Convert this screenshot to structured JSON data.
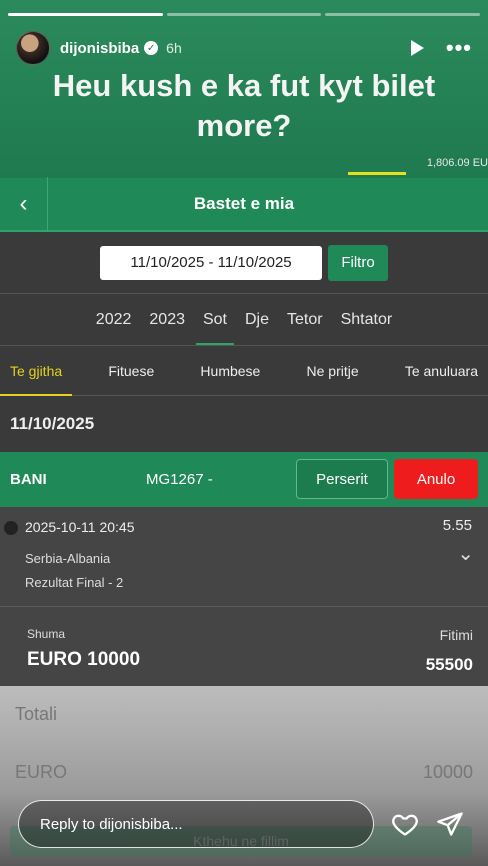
{
  "story": {
    "username": "dijonisbiba",
    "time": "6h",
    "caption": "Heu kush e ka fut kyt bilet more?",
    "peek_amount": "1,806.09 EU",
    "reply_placeholder": "Reply to dijonisbiba..."
  },
  "app": {
    "title": "Bastet e mia",
    "date_range": "11/10/2025 - 11/10/2025",
    "filter_label": "Filtro",
    "years": [
      "2022",
      "2023",
      "Sot",
      "Dje",
      "Tetor",
      "Shtator"
    ],
    "active_year": "Sot",
    "tabs": [
      "Te gjitha",
      "Fituese",
      "Humbese",
      "Ne pritje",
      "Te anuluara"
    ],
    "active_tab": "Te gjitha",
    "day": "11/10/2025",
    "bet": {
      "label": "BANI",
      "code": "MG1267 -",
      "rebet_label": "Perserit",
      "cancel_label": "Anulo",
      "datetime": "2025-10-11 20:45",
      "odds": "5.55",
      "match": "Serbia-Albania",
      "result": "Rezultat Final - 2",
      "stake_label": "Shuma",
      "stake_value": "EURO 10000",
      "win_label": "Fitimi",
      "win_value": "55500"
    },
    "totals": {
      "label": "Totali",
      "currency": "EURO",
      "value": "10000",
      "home_label": "Kthehu ne fillim"
    }
  },
  "colors": {
    "brand_green": "#1f8a57",
    "cancel_red": "#ee1c1c",
    "active_tab": "#e5d21c"
  }
}
